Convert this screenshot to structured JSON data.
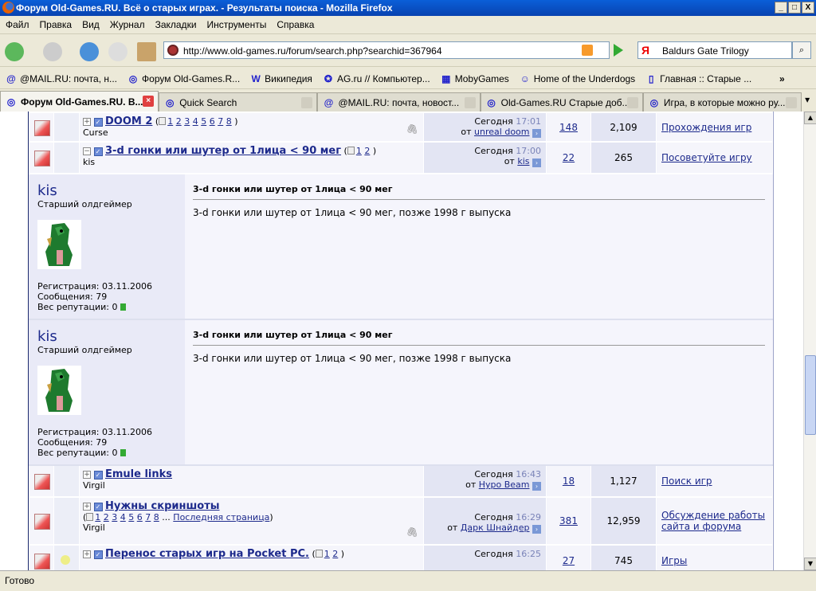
{
  "window": {
    "title": "Форум Old-Games.RU. Всё о старых играх. - Результаты поиска - Mozilla Firefox"
  },
  "menu": [
    "Файл",
    "Правка",
    "Вид",
    "Журнал",
    "Закладки",
    "Инструменты",
    "Справка"
  ],
  "address": {
    "url": "http://www.old-games.ru/forum/search.php?searchid=367964"
  },
  "search": {
    "value": "Baldurs Gate Trilogy",
    "engine_icon": "Я"
  },
  "bookmarks": [
    "@MAIL.RU: почта, н...",
    "Форум Old-Games.R...",
    "Википедия",
    "AG.ru // Компьютер...",
    "MobyGames",
    "Home of the Underdogs",
    "Главная :: Старые ..."
  ],
  "bookmark_icons": [
    "@",
    "◎",
    "W",
    "✪",
    "▦",
    "☺",
    "▯"
  ],
  "tabs": [
    "Форум Old-Games.RU. B...",
    "Quick Search",
    "@MAIL.RU: почта, новост...",
    "Old-Games.RU Старые доб...",
    "Игра, в которые можно ру..."
  ],
  "status": "Готово",
  "labels": {
    "today": "Сегодня",
    "by": "от",
    "last_page": "Последняя страница"
  },
  "topics": [
    {
      "title": "DOOM 2",
      "pages": [
        "1",
        "2",
        "3",
        "4",
        "5",
        "6",
        "7",
        "8"
      ],
      "author": "Curse",
      "time": "17:01",
      "last_poster": "unreal doom",
      "replies": "148",
      "views": "2,109",
      "forum": "Прохождения игр",
      "attach": true,
      "expanded": false
    },
    {
      "title": "3-d гонки или шутер от 1лица < 90 мег",
      "pages": [
        "1",
        "2"
      ],
      "author": "kis",
      "time": "17:00",
      "last_poster": "kis",
      "replies": "22",
      "views": "265",
      "forum": "Посоветуйте игру",
      "attach": false,
      "expanded": true
    }
  ],
  "posts": [
    {
      "username": "kis",
      "rank": "Старший олдгеймер",
      "reg": "Регистрация: 03.11.2006",
      "msgs": "Сообщения: 79",
      "rep": "Вес репутации: 0",
      "title": "3-d гонки или шутер от 1лица < 90 мег",
      "body": "3-d гонки или шутер от 1лица < 90 мег, позже 1998 г выпуска"
    },
    {
      "username": "kis",
      "rank": "Старший олдгеймер",
      "reg": "Регистрация: 03.11.2006",
      "msgs": "Сообщения: 79",
      "rep": "Вес репутации: 0",
      "title": "3-d гонки или шутер от 1лица < 90 мег",
      "body": "3-d гонки или шутер от 1лица < 90 мег, позже 1998 г выпуска"
    }
  ],
  "topics2": [
    {
      "title": "Emule links",
      "pages": [],
      "author": "Virgil",
      "time": "16:43",
      "last_poster": "Hypo Beam",
      "replies": "18",
      "views": "1,127",
      "forum": "Поиск игр",
      "attach": false,
      "expanded": false,
      "h": 40
    },
    {
      "title": "Нужны скриншоты",
      "pages": [
        "1",
        "2",
        "3",
        "4",
        "5",
        "6",
        "7",
        "8"
      ],
      "more": true,
      "author": "Virgil",
      "time": "16:29",
      "last_poster": "Дарк Шнайдер",
      "replies": "381",
      "views": "12,959",
      "forum": "Обсуждение работы сайта и форума",
      "attach": true,
      "expanded": false,
      "h": 60
    },
    {
      "title": "Перенос старых игр на Pocket PC.",
      "pages": [
        "1",
        "2"
      ],
      "author": "",
      "time": "16:25",
      "last_poster": "",
      "replies": "27",
      "views": "745",
      "forum": "Игры",
      "attach": false,
      "expanded": false,
      "h": 40,
      "hot": true
    }
  ]
}
